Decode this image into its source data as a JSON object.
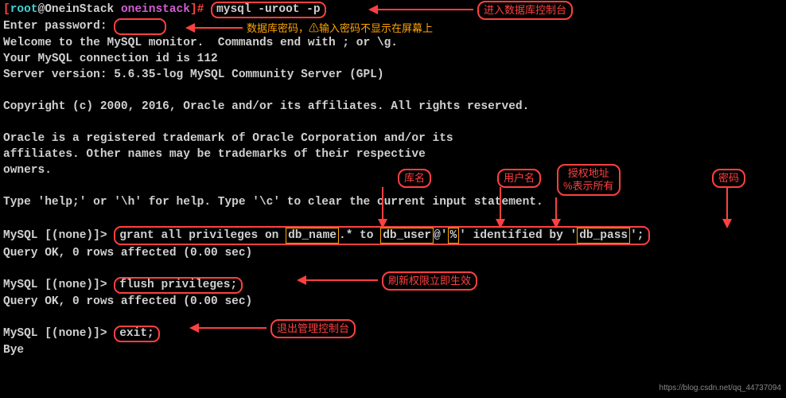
{
  "prompt": {
    "bracket_open": "[",
    "user": "root",
    "at_host": "@OneinStack ",
    "dir": "oneinstack",
    "bracket_close": "]# ",
    "cmd": "mysql -uroot -p"
  },
  "l2a": "Enter password:",
  "l3": "Welcome to the MySQL monitor.  Commands end with ; or \\g.",
  "l4": "Your MySQL connection id is 112",
  "l5": "Server version: 5.6.35-log MySQL Community Server (GPL)",
  "l6": "Copyright (c) 2000, 2016, Oracle and/or its affiliates. All rights reserved.",
  "l7": "Oracle is a registered trademark of Oracle Corporation and/or its",
  "l8": "affiliates. Other names may be trademarks of their respective",
  "l9": "owners.",
  "l10": "Type 'help;' or '\\h' for help. Type '\\c' to clear the current input statement.",
  "mysql_prompt": "MySQL [(none)]> ",
  "grant": {
    "a": "grant all privileges on ",
    "db": "db_name",
    "b": ".* to ",
    "user": "db_user",
    "c": "@'",
    "host": "%",
    "d": "' identified by '",
    "pass": "db_pass",
    "e": "';"
  },
  "ok": "Query OK, 0 rows affected (0.00 sec)",
  "flush": "flush privileges;",
  "exit": "exit;",
  "bye": "Bye",
  "callouts": {
    "enter_console": "进入数据库控制台",
    "password_note": "数据库密码，⚠输入密码不显示在屏幕上",
    "dbname": "库名",
    "username": "用户名",
    "grant_addr_l1": "授权地址",
    "grant_addr_l2": "%表示所有",
    "password": "密码",
    "flush_note": "刷新权限立即生效",
    "exit_note": "退出管理控制台"
  },
  "watermark": "https://blog.csdn.net/qq_44737094"
}
